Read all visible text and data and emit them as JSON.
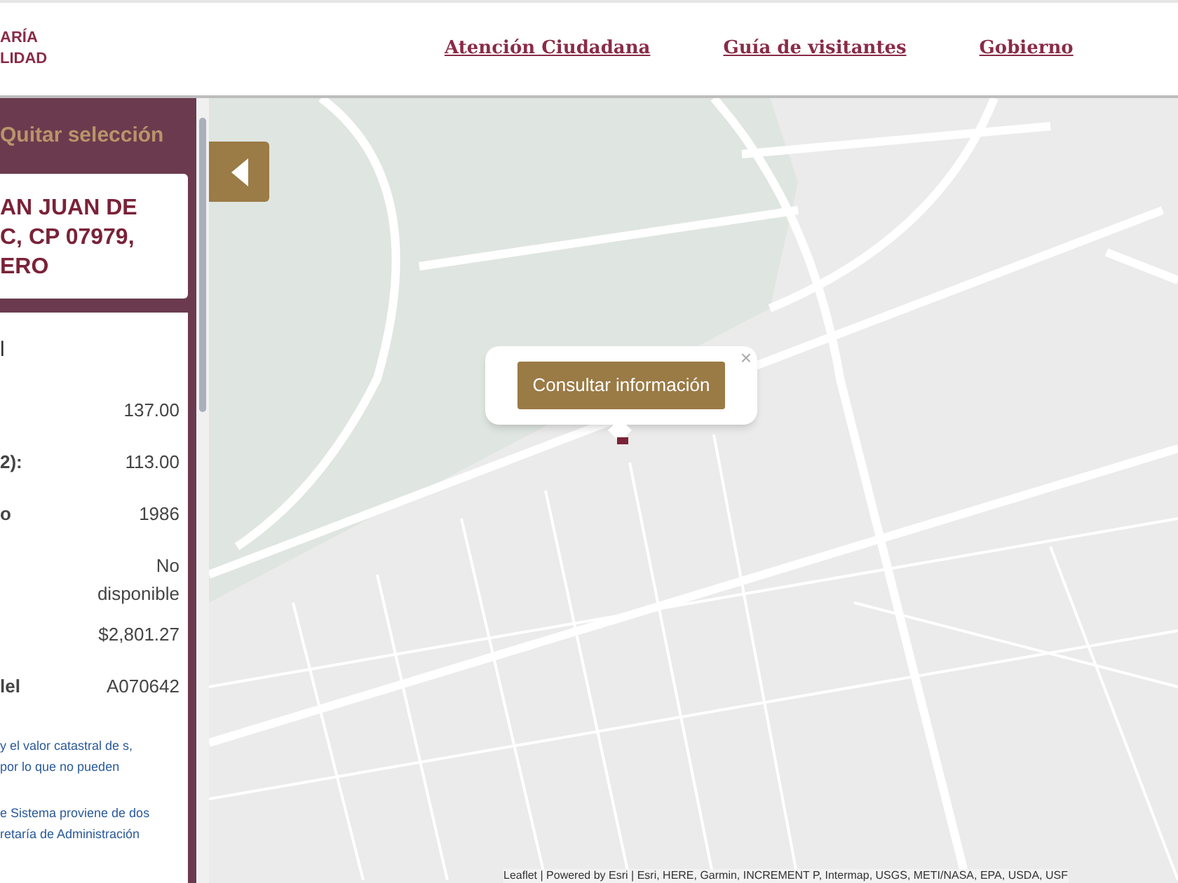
{
  "header": {
    "logo_lines": [
      "ARÍA",
      "LIDAD"
    ],
    "nav": [
      "Atención Ciudadana",
      "Guía de visitantes",
      "Gobierno"
    ]
  },
  "sidebar": {
    "clear_link": "Quitar selección",
    "address_lines": [
      "AN JUAN DE",
      "C, CP 07979,",
      "ERO"
    ],
    "details_title": "l",
    "rows": [
      {
        "label": "",
        "value": "137.00"
      },
      {
        "label": "2):",
        "value": "113.00"
      },
      {
        "label": "o",
        "value": "1986"
      },
      {
        "label": "",
        "value": "No disponible"
      },
      {
        "label": "",
        "value": "$2,801.27"
      },
      {
        "label": "lel",
        "value": "A070642"
      }
    ],
    "notes": [
      "y el valor catastral de s, por lo que no pueden",
      "e Sistema proviene de dos retaría de Administración"
    ]
  },
  "map": {
    "popup": {
      "button": "Consultar información",
      "close": "×"
    },
    "attribution": "Leaflet | Powered by Esri | Esri, HERE, Garmin, INCREMENT P, Intermap, USGS, METI/NASA, EPA, USDA, USF"
  }
}
